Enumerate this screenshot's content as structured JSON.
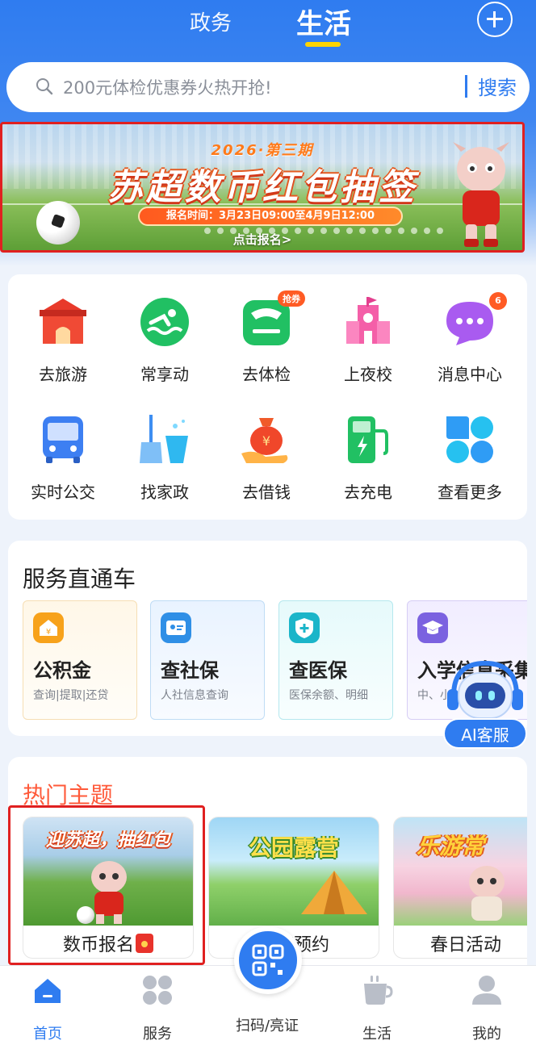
{
  "header": {
    "tab_gov": "政务",
    "tab_life": "生活",
    "plus_icon": "plus-circle-icon"
  },
  "search": {
    "placeholder": "200元体检优惠券火热开抢!",
    "button": "搜索"
  },
  "banner": {
    "subtitle": "2026·第三期",
    "title": "苏超数币红包抽签",
    "time": "报名时间：3月23日09:00至4月9日12:00",
    "cta": "点击报名>"
  },
  "grid": [
    {
      "label": "去旅游",
      "icon": "gate-icon"
    },
    {
      "label": "常享动",
      "icon": "swim-icon"
    },
    {
      "label": "去体检",
      "icon": "scale-icon",
      "badge": "抢券"
    },
    {
      "label": "上夜校",
      "icon": "school-icon"
    },
    {
      "label": "消息中心",
      "icon": "chat-bubble-icon",
      "badge": "6"
    },
    {
      "label": "实时公交",
      "icon": "bus-icon"
    },
    {
      "label": "找家政",
      "icon": "broom-icon"
    },
    {
      "label": "去借钱",
      "icon": "money-bag-icon"
    },
    {
      "label": "去充电",
      "icon": "charger-icon"
    },
    {
      "label": "查看更多",
      "icon": "more-grid-icon"
    }
  ],
  "services": {
    "title": "服务直通车",
    "tiles": [
      {
        "name": "公积金",
        "desc": "查询|提取|还贷",
        "color": "#f7a21b"
      },
      {
        "name": "查社保",
        "desc": "人社信息查询",
        "color": "#2f8fe6"
      },
      {
        "name": "查医保",
        "desc": "医保余额、明细",
        "color": "#1bb5c9"
      },
      {
        "name": "入学信息采集",
        "desc": "中、小",
        "color": "#7b62e0"
      }
    ],
    "ai_label": "AI客服"
  },
  "hot": {
    "title": "热门主题",
    "items": [
      {
        "image_text": "迎苏超，抽红包",
        "caption": "数币报名"
      },
      {
        "image_text": "公园露营",
        "caption": "露营预约"
      },
      {
        "image_text": "乐游常",
        "caption": "春日活动"
      }
    ]
  },
  "nav": {
    "home": "首页",
    "service": "服务",
    "scan": "扫码/亮证",
    "life": "生活",
    "mine": "我的"
  },
  "colors": {
    "primary": "#2f7cf0",
    "accent_red": "#e02020",
    "hot_title": "#ff5a3a"
  }
}
